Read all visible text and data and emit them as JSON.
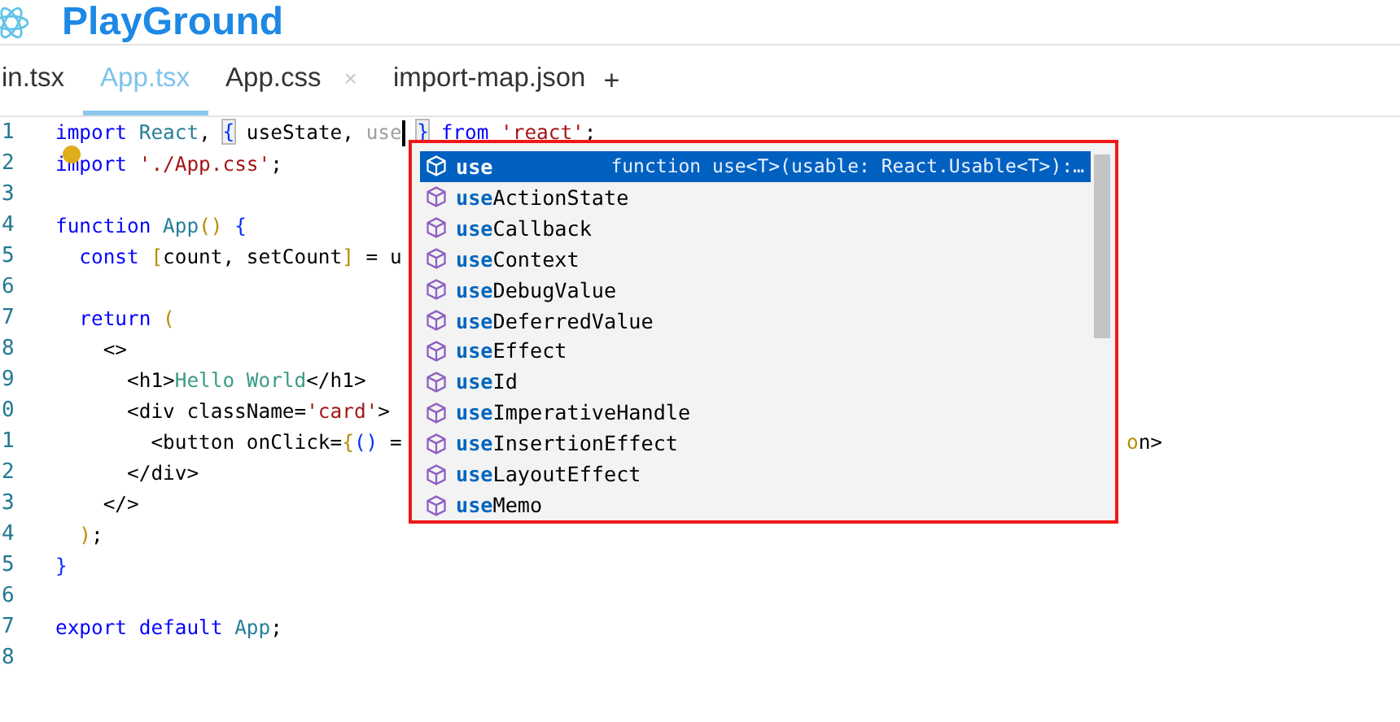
{
  "header": {
    "title": "PlayGround"
  },
  "tabs": [
    {
      "label": "in.tsx",
      "selected": false
    },
    {
      "label": "App.tsx",
      "selected": true
    },
    {
      "label": "App.css",
      "selected": false,
      "close": "×"
    },
    {
      "label": "import-map.json",
      "selected": false
    }
  ],
  "add_tab": "+",
  "editor": {
    "lines": [
      {
        "number": "1",
        "tokens": [
          {
            "kind": "kw",
            "text": "import "
          },
          {
            "kind": "type",
            "text": "React"
          },
          {
            "kind": "plain",
            "text": ", "
          },
          {
            "kind": "match",
            "text": "{"
          },
          {
            "kind": "plain",
            "text": " useState, "
          },
          {
            "kind": "ghost",
            "text": "use",
            "caret_after": true
          },
          {
            "kind": "match",
            "text": "}"
          },
          {
            "kind": "kw",
            "text": " from "
          },
          {
            "kind": "str",
            "text": "'react'"
          },
          {
            "kind": "plain",
            "text": ";"
          }
        ]
      },
      {
        "number": "2",
        "lightbulb": true,
        "tokens": [
          {
            "kind": "kw",
            "text": "import "
          },
          {
            "kind": "str",
            "text": "'./App.css'"
          },
          {
            "kind": "plain",
            "text": ";"
          }
        ]
      },
      {
        "number": "3"
      },
      {
        "number": "4",
        "tokens": [
          {
            "kind": "kw",
            "text": "function "
          },
          {
            "kind": "type",
            "text": "App"
          },
          {
            "kind": "gold",
            "text": "() "
          },
          {
            "kind": "blue",
            "text": "{"
          }
        ]
      },
      {
        "number": "5",
        "tokens": [
          {
            "kind": "kw",
            "text": "  const "
          },
          {
            "kind": "gold",
            "text": "["
          },
          {
            "kind": "plain",
            "text": "count, setCount"
          },
          {
            "kind": "gold",
            "text": "]"
          },
          {
            "kind": "plain",
            "text": " = u"
          }
        ]
      },
      {
        "number": "6"
      },
      {
        "number": "7",
        "tokens": [
          {
            "kind": "kw",
            "text": "  return "
          },
          {
            "kind": "gold",
            "text": "("
          }
        ]
      },
      {
        "number": "8",
        "tokens": [
          {
            "kind": "plain",
            "text": "    <>"
          }
        ]
      },
      {
        "number": "9",
        "tokens": [
          {
            "kind": "plain",
            "text": "      <h1>"
          },
          {
            "kind": "jsx",
            "text": "Hello World"
          },
          {
            "kind": "plain",
            "text": "</h1>"
          }
        ]
      },
      {
        "number": "0",
        "tokens": [
          {
            "kind": "plain",
            "text": "      <div className="
          },
          {
            "kind": "str",
            "text": "'card'"
          },
          {
            "kind": "plain",
            "text": ">"
          }
        ]
      },
      {
        "number": "1",
        "tokens": [
          {
            "kind": "plain",
            "text": "        <button onClick="
          },
          {
            "kind": "gold",
            "text": "{"
          },
          {
            "kind": "blue",
            "text": "()"
          },
          {
            "kind": "plain",
            "text": " ="
          }
        ],
        "tail": "on>"
      },
      {
        "number": "2",
        "tokens": [
          {
            "kind": "plain",
            "text": "      </div>"
          }
        ]
      },
      {
        "number": "3",
        "tokens": [
          {
            "kind": "plain",
            "text": "    </>"
          }
        ]
      },
      {
        "number": "4",
        "tokens": [
          {
            "kind": "gold",
            "text": "  )"
          },
          {
            "kind": "plain",
            "text": ";"
          }
        ]
      },
      {
        "number": "5",
        "tokens": [
          {
            "kind": "blue",
            "text": "}"
          }
        ]
      },
      {
        "number": "6"
      },
      {
        "number": "7",
        "tokens": [
          {
            "kind": "kw",
            "text": "export default "
          },
          {
            "kind": "type",
            "text": "App"
          },
          {
            "kind": "plain",
            "text": ";"
          }
        ]
      },
      {
        "number": "8"
      }
    ]
  },
  "suggestions": {
    "detail": "function use<T>(usable: React.Usable<T>):…",
    "items": [
      {
        "match": "use",
        "selected": true
      },
      {
        "match": "use",
        "rest": "ActionState",
        "selected": false
      },
      {
        "match": "use",
        "rest": "Callback",
        "selected": false
      },
      {
        "match": "use",
        "rest": "Context",
        "selected": false
      },
      {
        "match": "use",
        "rest": "DebugValue",
        "selected": false
      },
      {
        "match": "use",
        "rest": "DeferredValue",
        "selected": false
      },
      {
        "match": "use",
        "rest": "Effect",
        "selected": false
      },
      {
        "match": "use",
        "rest": "Id",
        "selected": false
      },
      {
        "match": "use",
        "rest": "ImperativeHandle",
        "selected": false
      },
      {
        "match": "use",
        "rest": "InsertionEffect",
        "selected": false
      },
      {
        "match": "use",
        "rest": "LayoutEffect",
        "selected": false
      },
      {
        "match": "use",
        "rest": "Memo",
        "selected": false
      }
    ]
  }
}
